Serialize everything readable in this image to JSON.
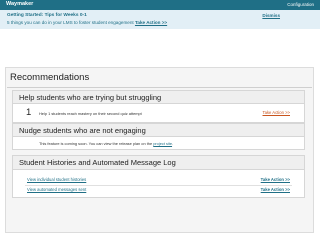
{
  "topbar": {
    "brand": "Waymaker",
    "config": "Configuration"
  },
  "tips": {
    "title": "Getting Started: Tips for Weeks 0-1",
    "text": "5 things you can do in your LMS to foster student engagement",
    "action": "Take Action >>",
    "dismiss": "Dismiss"
  },
  "recommendations": {
    "title": "Recommendations",
    "help": {
      "title": "Help students who are trying but struggling",
      "number": "1",
      "text": "Help 1 students reach mastery on their second quiz attempt",
      "action": "Take Action >>"
    },
    "nudge": {
      "title": "Nudge students who are not engaging",
      "text": "This feature is coming soon. You can view the release plan on the",
      "link": "project site",
      "suffix": "."
    }
  },
  "history": {
    "title": "Student Histories and Automated Message Log",
    "rows": [
      {
        "label": "View individual student histories",
        "action": "Take Action >>"
      },
      {
        "label": "View automated messages sent",
        "action": "Take Action >>"
      }
    ]
  },
  "colors": {
    "brand": "#1f6f86",
    "tips_bg": "#e2eff6",
    "action_orange": "#c9541d"
  }
}
